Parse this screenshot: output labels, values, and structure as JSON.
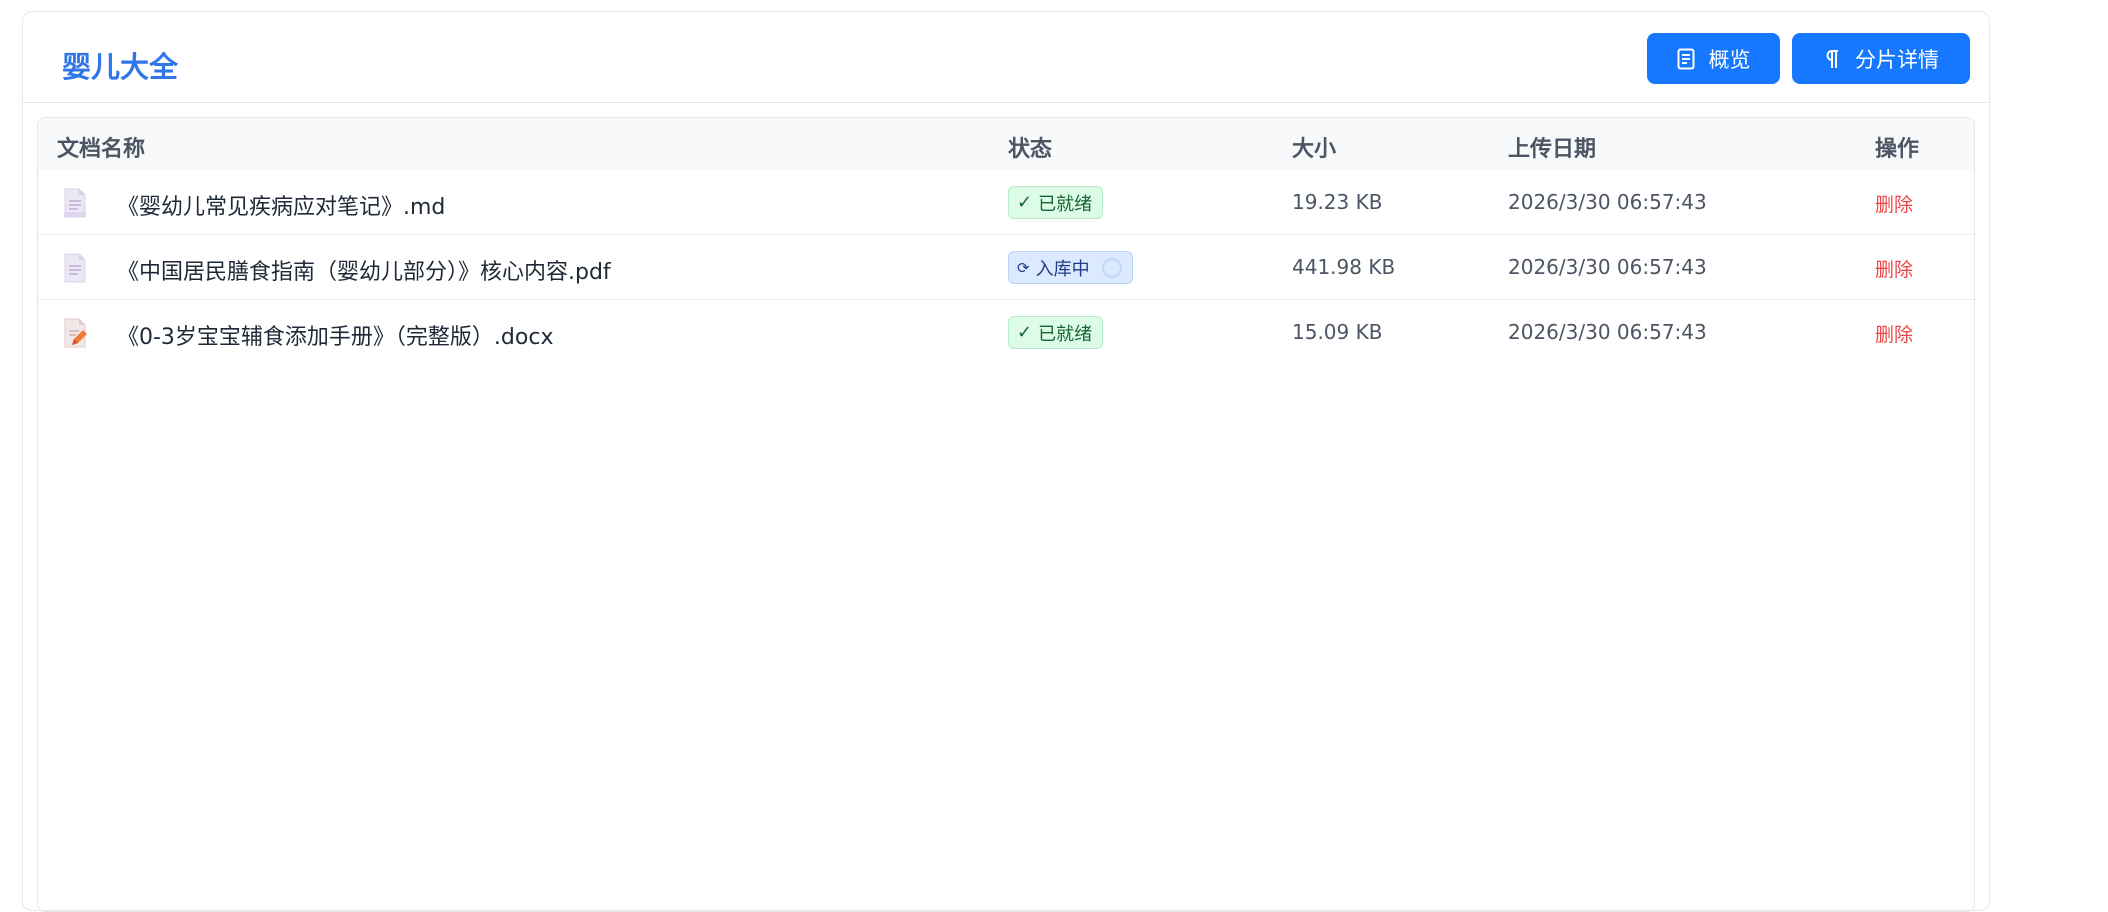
{
  "header": {
    "title": "婴儿大全",
    "overview_label": "概览",
    "chunk_details_label": "分片详情"
  },
  "table": {
    "columns": [
      "文档名称",
      "状态",
      "大小",
      "上传日期",
      "操作"
    ],
    "rows": [
      {
        "name": "《婴幼儿常见疾病应对笔记》.md",
        "icon": "markdown-file-icon",
        "status": "已就绪",
        "status_kind": "ready",
        "size": "19.23 KB",
        "date": "2026/3/30 06:57:43",
        "action": "删除"
      },
      {
        "name": "《中国居民膳食指南（婴幼儿部分）》核心内容.pdf",
        "icon": "pdf-file-icon",
        "status": "入库中",
        "status_kind": "loading",
        "size": "441.98 KB",
        "date": "2026/3/30 06:57:43",
        "action": "删除"
      },
      {
        "name": "《0-3岁宝宝辅食添加手册》（完整版）.docx",
        "icon": "docx-file-icon",
        "status": "已就绪",
        "status_kind": "ready",
        "size": "15.09 KB",
        "date": "2026/3/30 06:57:43",
        "action": "删除"
      }
    ]
  },
  "colors": {
    "accent": "#1677ff",
    "title": "#2f76e8",
    "delete": "#ef4444",
    "ready_bg": "#dcfce7",
    "loading_bg": "#dbeafe"
  }
}
